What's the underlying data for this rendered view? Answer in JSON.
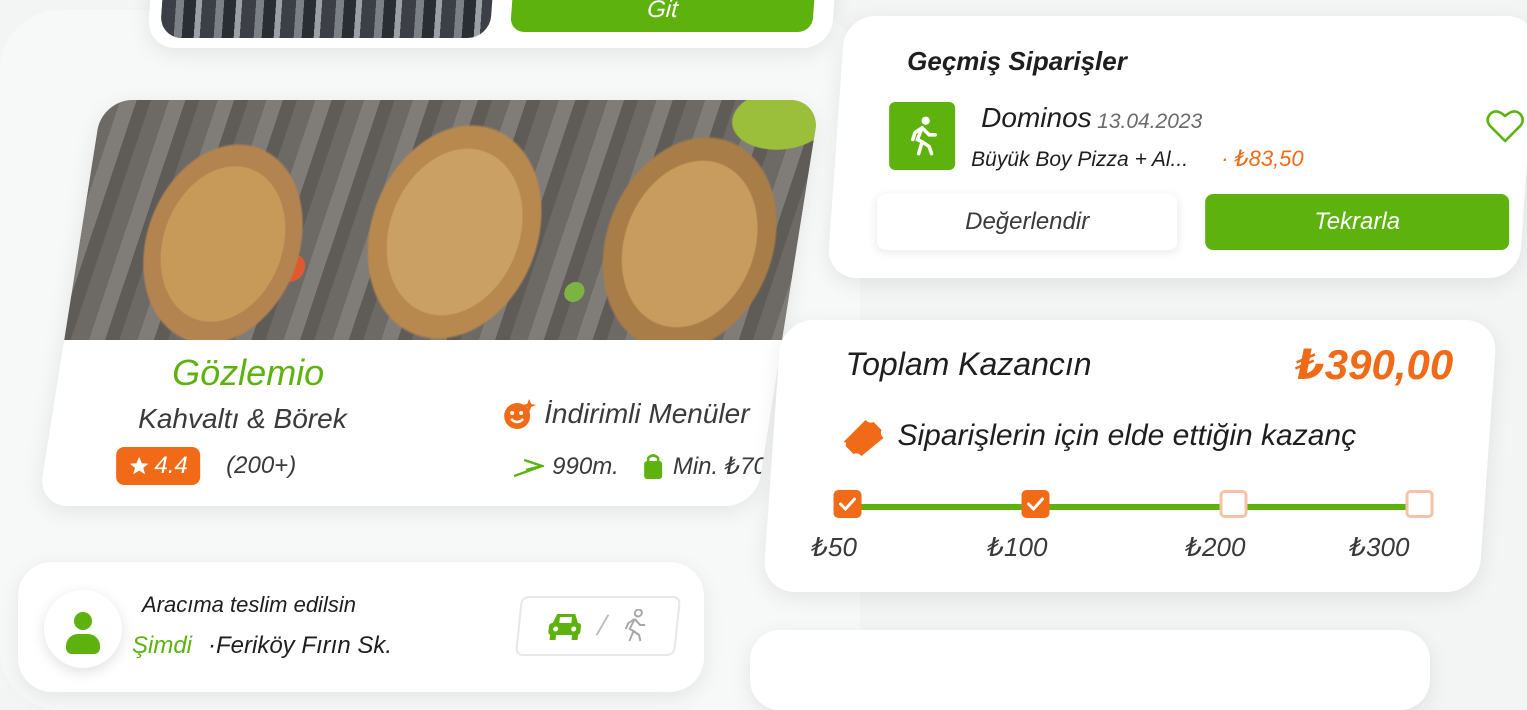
{
  "top_card": {
    "button_label": "Git"
  },
  "restaurant": {
    "name": "Gözlemio",
    "category": "Kahvaltı & Börek",
    "promo": "İndirimli Menüler",
    "rating": "4.4",
    "review_count": "(200+)",
    "distance": "990m.",
    "min_order": "Min. ₺70"
  },
  "delivery": {
    "title": "Aracıma teslim edilsin",
    "time": "Şimdi",
    "address": "·Feriköy Fırın Sk.",
    "separator": "/"
  },
  "past_orders": {
    "title": "Geçmiş Siparişler",
    "shop": "Dominos",
    "date": "13.04.2023",
    "items": "Büyük Boy Pizza + Al...",
    "price": "· ₺83,50",
    "rate_label": "Değerlendir",
    "repeat_label": "Tekrarla"
  },
  "earnings": {
    "title": "Toplam Kazancın",
    "total": "₺390,00",
    "subtitle": "Siparişlerin için elde ettiğin kazanç",
    "milestones": [
      {
        "label": "₺50",
        "done": true
      },
      {
        "label": "₺100",
        "done": true
      },
      {
        "label": "₺200",
        "done": false
      },
      {
        "label": "₺300",
        "done": false
      }
    ]
  },
  "colors": {
    "green": "#5db20e",
    "orange": "#f06a18"
  },
  "icons": [
    "star-icon",
    "discount-icon",
    "distance-icon",
    "bag-icon",
    "walking-icon",
    "heart-icon",
    "ticket-icon",
    "car-icon",
    "check-icon",
    "user-icon"
  ]
}
